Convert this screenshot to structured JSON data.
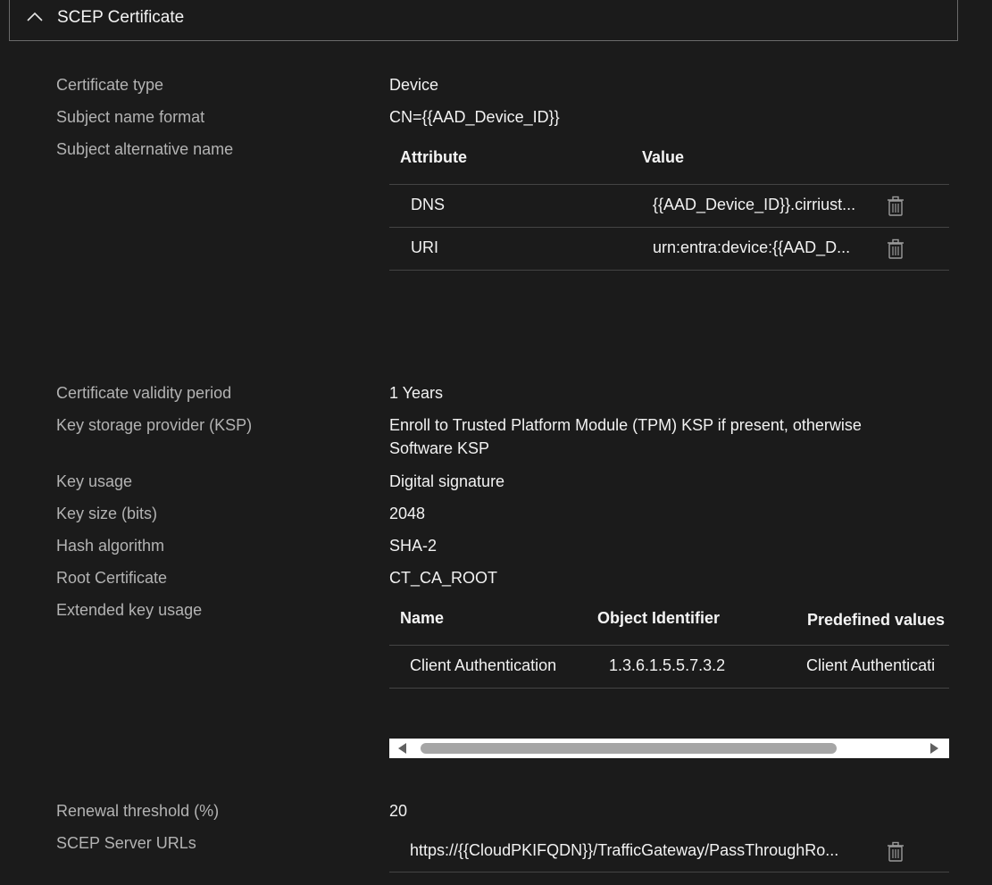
{
  "section": {
    "title": "SCEP Certificate",
    "expanded": true
  },
  "fields": {
    "cert_type_label": "Certificate type",
    "cert_type_value": "Device",
    "subject_format_label": "Subject name format",
    "subject_format_value": "CN={{AAD_Device_ID}}",
    "san_label": "Subject alternative name",
    "validity_label": "Certificate validity period",
    "validity_value": "1 Years",
    "ksp_label": "Key storage provider (KSP)",
    "ksp_value": "Enroll to Trusted Platform Module (TPM) KSP if present, otherwise Software KSP",
    "key_usage_label": "Key usage",
    "key_usage_value": "Digital signature",
    "key_size_label": "Key size (bits)",
    "key_size_value": "2048",
    "hash_label": "Hash algorithm",
    "hash_value": "SHA-2",
    "root_label": "Root Certificate",
    "root_value": "CT_CA_ROOT",
    "eku_label": "Extended key usage",
    "renewal_label": "Renewal threshold (%)",
    "renewal_value": "20",
    "scep_urls_label": "SCEP Server URLs"
  },
  "san_table": {
    "columns": [
      "Attribute",
      "Value"
    ],
    "rows": [
      {
        "attribute": "DNS",
        "value": "{{AAD_Device_ID}}.cirriust..."
      },
      {
        "attribute": "URI",
        "value": "urn:entra:device:{{AAD_D..."
      }
    ]
  },
  "eku_table": {
    "columns": [
      "Name",
      "Object Identifier",
      "Predefined values"
    ],
    "rows": [
      {
        "name": "Client Authentication",
        "oid": "1.3.6.1.5.5.7.3.2",
        "predefined": "Client Authenticati"
      }
    ]
  },
  "scep_urls": [
    "https://{{CloudPKIFQDN}}/TrafficGateway/PassThroughRo..."
  ],
  "icons": {
    "collapse": "chevron-up-icon",
    "delete": "trash-icon"
  }
}
